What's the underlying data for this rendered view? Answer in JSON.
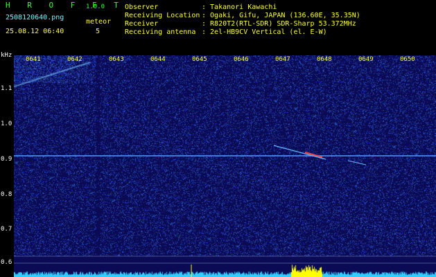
{
  "header": {
    "app_name": "H R O F F T",
    "version": "1.0.0",
    "filename": "2508120640.png",
    "event_label": "meteor",
    "datetime": "25.08.12 06:40",
    "event_count": "5",
    "info": [
      {
        "label": "Observer",
        "value": ": Takanori Kawachi"
      },
      {
        "label": "Receiving Location",
        "value": ": Ogaki, Gifu, JAPAN (136.60E, 35.35N)"
      },
      {
        "label": "Receiver",
        "value": ": R820T2(RTL-SDR) SDR-Sharp 53.372MHz"
      },
      {
        "label": "Receiving antenna",
        "value": ": 2el-HB9CV Vertical (el. E-W)"
      }
    ]
  },
  "axis": {
    "unit": "kHz",
    "y_ticks": [
      "1.1",
      "1.0",
      "0.9",
      "0.8",
      "0.7",
      "0.6"
    ],
    "time_ticks": [
      "0641",
      "0642",
      "0643",
      "0644",
      "0645",
      "0646",
      "0647",
      "0648",
      "0649",
      "0650"
    ]
  },
  "colors": {
    "background": "#0a0a55",
    "noise": "#2244cc",
    "carrier": "#55aaff",
    "meteor_head": "#ff4444",
    "spectrum": "#33ccff",
    "spectrum_peak": "#ffff00"
  }
}
